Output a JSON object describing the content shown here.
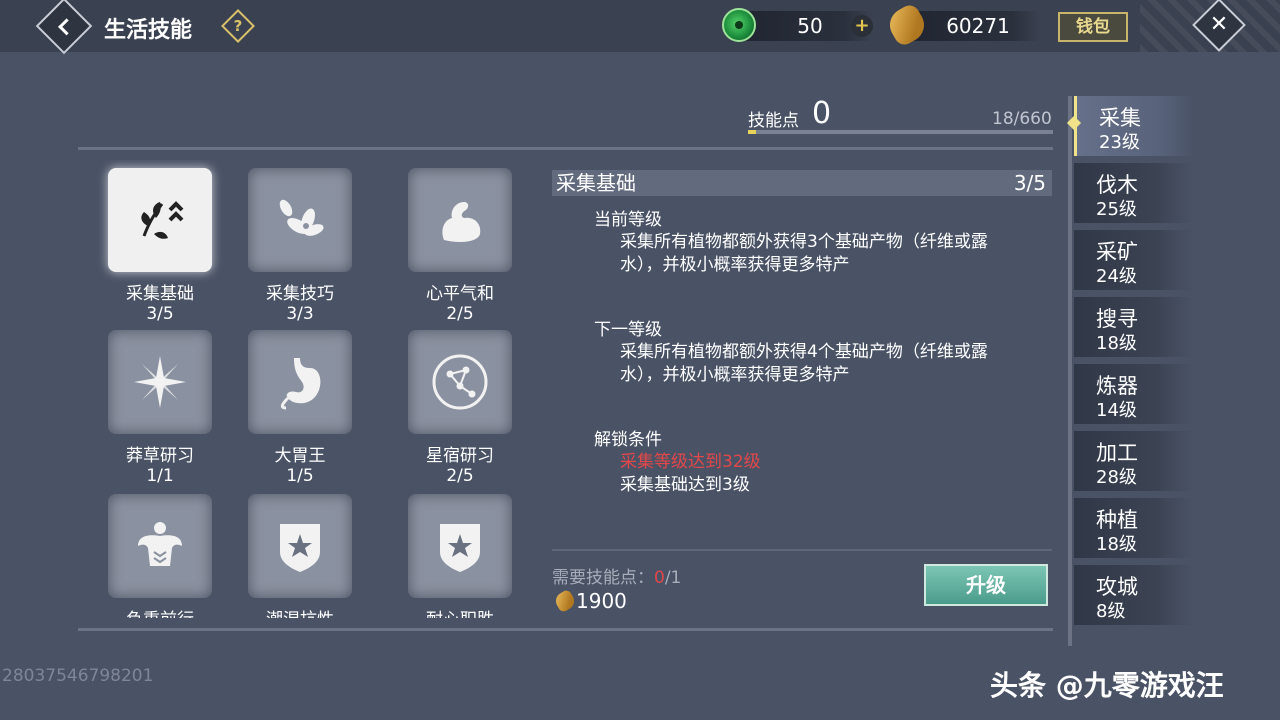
{
  "header": {
    "title": "生活技能",
    "help_label": "?",
    "jade_amount": "50",
    "coin_amount": "60271",
    "plus_label": "+",
    "wallet_label": "钱包",
    "close_label": "✕"
  },
  "skill_points": {
    "label": "技能点",
    "value": "0",
    "progress_text": "18/660",
    "progress_fraction": 0.027
  },
  "skills": [
    {
      "name": "采集基础",
      "level": "3/5",
      "icon": "herb-arrow-icon",
      "selected": true
    },
    {
      "name": "采集技巧",
      "level": "3/3",
      "icon": "flower-icon",
      "selected": false
    },
    {
      "name": "心平气和",
      "level": "2/5",
      "icon": "arm-muscle-icon",
      "selected": false
    },
    {
      "name": "莽草研习",
      "level": "1/1",
      "icon": "star-flower-icon",
      "selected": false
    },
    {
      "name": "大胃王",
      "level": "1/5",
      "icon": "stomach-icon",
      "selected": false
    },
    {
      "name": "星宿研习",
      "level": "2/5",
      "icon": "constellation-icon",
      "selected": false
    },
    {
      "name": "负重前行",
      "level": "",
      "icon": "body-muscle-icon",
      "selected": false
    },
    {
      "name": "潮湿抗性",
      "level": "",
      "icon": "star-banner-icon",
      "selected": false
    },
    {
      "name": "耐心职胜",
      "level": "",
      "icon": "star-banner-icon",
      "selected": false
    }
  ],
  "detail": {
    "title": "采集基础",
    "level": "3/5",
    "current_title": "当前等级",
    "current_text": "采集所有植物都额外获得3个基础产物（纤维或露水），并极小概率获得更多特产",
    "next_title": "下一等级",
    "next_text": "采集所有植物都额外获得4个基础产物（纤维或露水），并极小概率获得更多特产",
    "unlock_title": "解锁条件",
    "unlock_req1": "采集等级达到32级",
    "unlock_req2": "采集基础达到3级",
    "need_label": "需要技能点：",
    "need_have": "0",
    "need_total": "/1",
    "cost": "1900",
    "upgrade_label": "升级"
  },
  "tabs": [
    {
      "name": "采集",
      "level": "23级",
      "active": true
    },
    {
      "name": "伐木",
      "level": "25级",
      "active": false
    },
    {
      "name": "采矿",
      "level": "24级",
      "active": false
    },
    {
      "name": "搜寻",
      "level": "18级",
      "active": false
    },
    {
      "name": "炼器",
      "level": "14级",
      "active": false
    },
    {
      "name": "加工",
      "level": "28级",
      "active": false
    },
    {
      "name": "种植",
      "level": "18级",
      "active": false
    },
    {
      "name": "攻城",
      "level": "8级",
      "active": false
    }
  ],
  "uid": "28037546798201",
  "watermark": "头条 @九零游戏汪",
  "colors": {
    "background": "#4a5366",
    "topbar": "#3a4150",
    "accent_gold": "#e8d35a",
    "warning_red": "#e2474a",
    "upgrade_green": "#5aab9a"
  }
}
